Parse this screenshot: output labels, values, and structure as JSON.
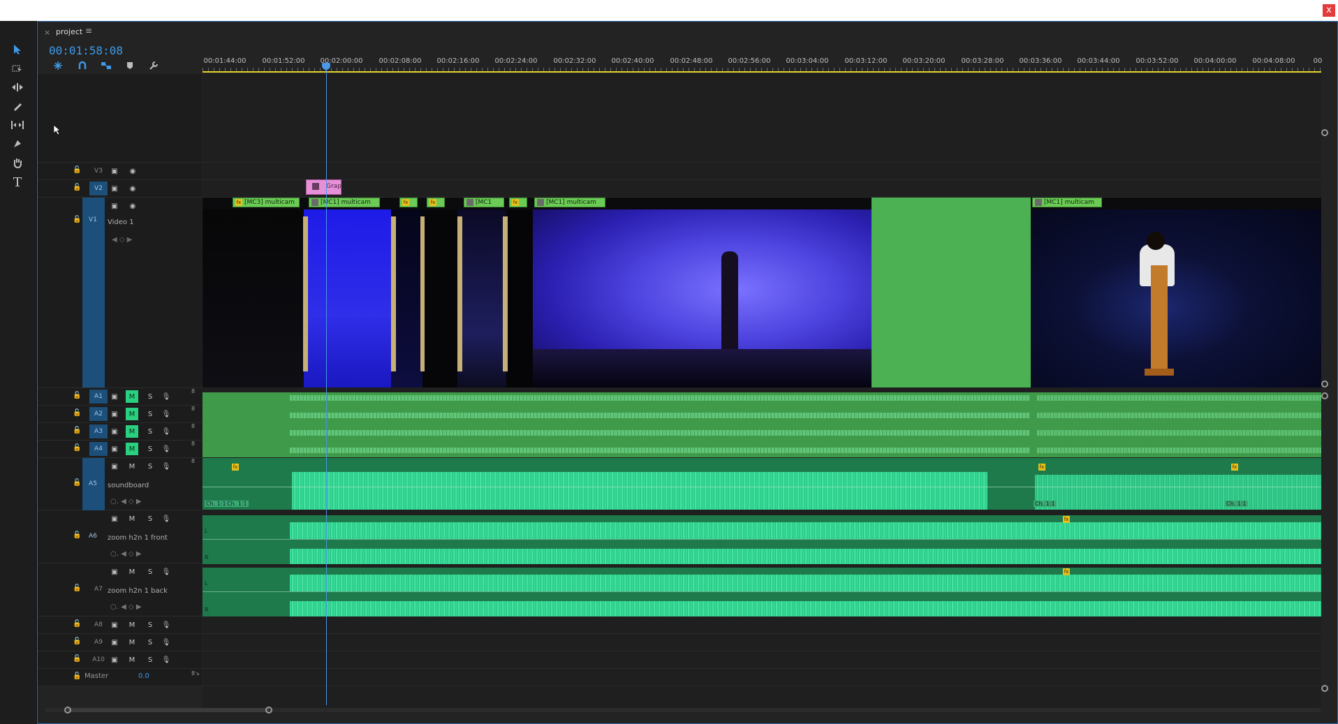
{
  "window": {
    "close_label": "x"
  },
  "panel": {
    "tab_close": "×",
    "tab_name": "project",
    "tab_menu": "≡",
    "timecode": "00:01:58:08"
  },
  "ruler": {
    "ticks": [
      "00:01:44:00",
      "00:01:52:00",
      "00:02:00:00",
      "00:02:08:00",
      "00:02:16:00",
      "00:02:24:00",
      "00:02:32:00",
      "00:02:40:00",
      "00:02:48:00",
      "00:02:56:00",
      "00:03:04:00",
      "00:03:12:00",
      "00:03:20:00",
      "00:03:28:00",
      "00:03:36:00",
      "00:03:44:00",
      "00:03:52:00",
      "00:04:00:00",
      "00:04:08:00",
      "00"
    ]
  },
  "tracks": {
    "v3": "V3",
    "v2": "V2",
    "v1": "V1",
    "v1_name": "Video 1",
    "a1": "A1",
    "a2": "A2",
    "a3": "A3",
    "a4": "A4",
    "a5": "A5",
    "a6": "A6",
    "a7": "A7",
    "a8": "A8",
    "a9": "A9",
    "a10": "A10",
    "a5_name": "soundboard",
    "a6_name": "zoom h2n 1 front",
    "a7_name": "zoom h2n 1 back",
    "master": "Master",
    "master_value": "0.0",
    "mute": "M",
    "solo": "S",
    "channels": "8"
  },
  "clips": {
    "graphic": "Grap",
    "mc3": "[MC3] multicam",
    "mc1a": "[MC1] multicam",
    "mc1b": "[MC1",
    "mc1c": "[MC1] multicam",
    "mc1d": "[MC1] multicam",
    "fx": "fx",
    "ch11": "Ch. 1:1",
    "left": "L",
    "right": "R"
  }
}
